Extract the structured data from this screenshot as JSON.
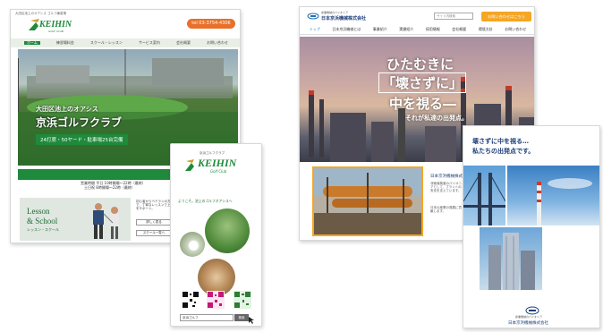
{
  "golf_site": {
    "top_note": "大田区池上のオアシス ゴルフ練習場",
    "logo_text": "KEIHIN",
    "logo_sub": "GOLF CLUB",
    "phone_label": "tel 03-3754-4306",
    "nav": [
      "ホーム",
      "練習場料金",
      "スクール・レッスン",
      "サービス案内",
      "会社概要",
      "お問い合わせ"
    ],
    "hero_tagline": "大田区池上のオアシス",
    "hero_title": "京浜ゴルフクラブ",
    "hero_band": "24打席・50ヤード・駐車場25台完備",
    "hours_line1": "営業時間 平日 10時開場～22時（最終）",
    "hours_line2": "土日祝 8時開場～22時（最終）",
    "lesson_title": "Lesson",
    "lesson_amp": "& School",
    "lesson_sub": "レッスン・スクール",
    "lesson_text": "初心者からベテランの方まで、丁寧なレッスンで上達をサポート。",
    "more_button": "詳しく見る",
    "more_button2": "スクール一覧へ"
  },
  "golf_mobile": {
    "header_small": "京浜ゴルフクラブ",
    "logo_text": "KEIHIN",
    "logo_sub": "Golf Club",
    "welcome": "ようこそ。池上のゴルフオアシスへ",
    "qr_labels": [
      "HP",
      "Instagram",
      "BLOG"
    ],
    "search_value": "京浜ゴルフ",
    "search_button": "検索"
  },
  "corp_site": {
    "company_small": "産業機械のパイオニア",
    "company_name": "日本京浜機械株式会社",
    "search_placeholder": "サイト内検索",
    "contact_button": "お問い合わせはこちら",
    "nav": [
      "トップ",
      "日本京浜機械とは",
      "事業紹介",
      "実績紹介",
      "採用情報",
      "会社概要",
      "環境方針",
      "お問い合わせ"
    ],
    "hero_line1": "ひたむきに",
    "hero_line2": "「壊さずに」",
    "hero_line3": "中を視る―",
    "hero_line4": "それが私達の出発点。",
    "about_title": "日本京浜機械株式会社は",
    "about_text": "非破壊検査のパイオニアとして、プラントの安全を支えています。",
    "about_text2": "日本の産業の発展に貢献します。"
  },
  "corp_brochure": {
    "headline1": "壊さずに中を視る…",
    "headline2": "私たちの出発点です。",
    "footer_small": "産業機械のパイオニア",
    "footer_name": "日本京浜機械株式会社"
  },
  "colors": {
    "golf_green": "#1f8a3b",
    "golf_orange": "#e8702a",
    "corp_blue": "#1e6fb8",
    "corp_navy": "#1d3f7a",
    "corp_yellow": "#f5a623"
  }
}
